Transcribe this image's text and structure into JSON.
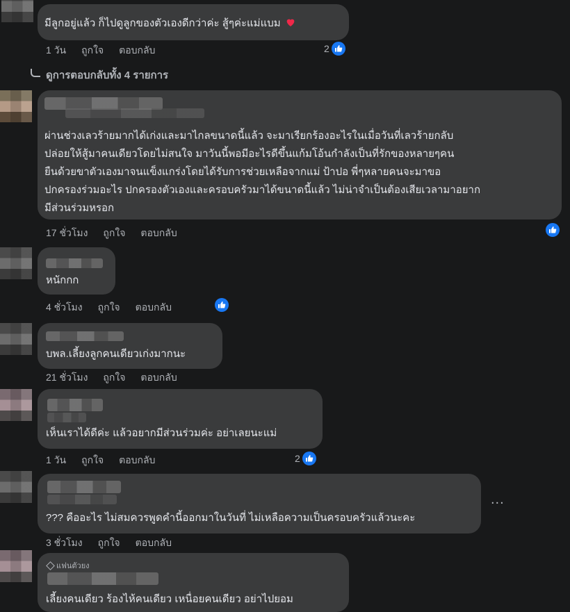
{
  "colors": {
    "background": "#18191a",
    "bubble": "#3a3b3c",
    "text": "#e4e6eb",
    "meta": "#b0b3b8",
    "like_blue": "#1877f2",
    "heart": "#f02849"
  },
  "actions": {
    "like": "ถูกใจ",
    "reply": "ตอบกลับ"
  },
  "comments": [
    {
      "id": "c1",
      "text_lines": [
        "มีลูกอยู่แล้ว ก็ไปดูลูกของตัวเองดีกว่าค่ะ สู้ๆค่ะแม่แบม"
      ],
      "emoji": "heart",
      "time": "1 วัน",
      "like_count": "2"
    },
    {
      "id": "replies",
      "label": "ดูการตอบกลับทั้ง 4 รายการ"
    },
    {
      "id": "c2",
      "text_lines": [
        "ผ่านช่วงเลวร้ายมากได้เก่งและมาไกลขนาดนี้แล้ว จะมาเรียกร้องอะไรในเมื่อวันที่เลวร้ายกลับ",
        "ปล่อยให้สู้มาคนเดียวโดยไม่สนใจ มาวันนี้พอมีอะไรดีขึ้นแก้มโอ้นกำลังเป็นที่รักของหลายๆคน",
        "ยืนด้วยขาตัวเองมาจนแข็งแกร่งโดยได้รับการช่วยเหลือจากแม่ ป้าปอ พี่ๆหลายคนจะมาขอ",
        "ปกครองร่วมอะไร ปกครองตัวเองและครอบครัวมาได้ขนาดนี้แล้ว ไม่น่าจำเป็นต้องเสียเวลามาอยาก",
        "มีส่วนร่วมหรอก"
      ],
      "time": "17 ชั่วโมง"
    },
    {
      "id": "c3",
      "text_lines": [
        "หนักกก"
      ],
      "time": "4 ชั่วโมง"
    },
    {
      "id": "c4",
      "text_lines": [
        "บพล.เลี้ยงลูกคนเดียวเก่งมากนะ"
      ],
      "time": "21 ชั่วโมง"
    },
    {
      "id": "c5",
      "text_lines": [
        "เห็นเราได้ดีค่ะ แล้วอยากมีส่วนร่วมค่ะ อย่าเลยนะแม่"
      ],
      "time": "1 วัน",
      "like_count": "2"
    },
    {
      "id": "c6",
      "text_lines": [
        "??? คืออะไร ไม่สมควรพูดคำนี้ออกมาในวันที่ ไม่เหลือความเป็นครอบครัวแล้วนะคะ"
      ],
      "time": "3 ชั่วโมง",
      "more": "..."
    },
    {
      "id": "c7",
      "badge": "แฟนตัวยง",
      "text_lines": [
        "เลี้ยงคนเดียว ร้องไห้คนเดียว เหนื่อยคนเดียว อย่าไปยอม"
      ]
    }
  ]
}
